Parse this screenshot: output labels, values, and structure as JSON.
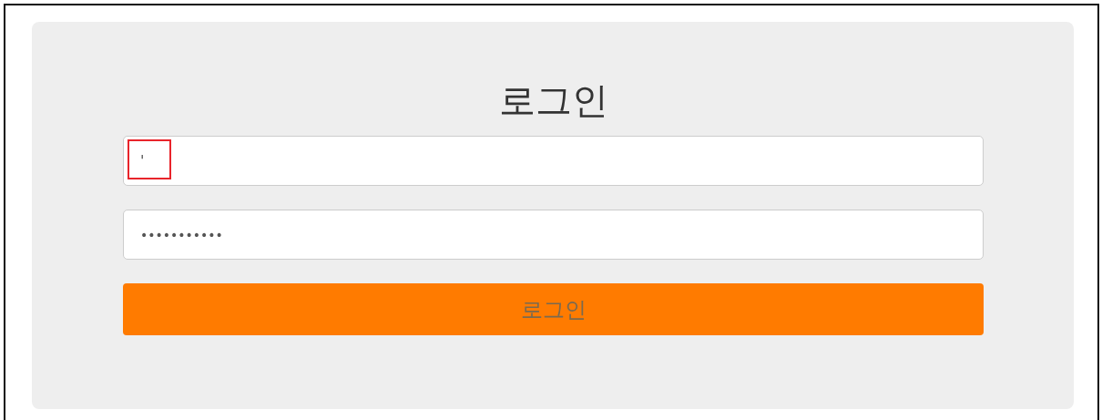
{
  "title": "로그인",
  "fields": [
    {
      "kind": "text",
      "value": "'",
      "highlighted": true
    },
    {
      "kind": "password",
      "value": "•••••••••••",
      "highlighted": false
    }
  ],
  "button": {
    "label": "로그인"
  }
}
